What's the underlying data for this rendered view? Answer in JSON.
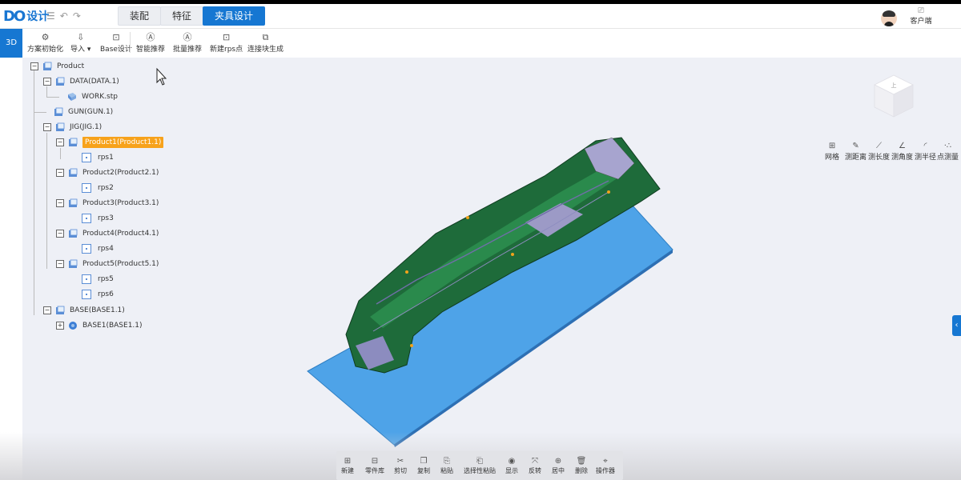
{
  "header": {
    "logo_mark": "DO",
    "logo_text": "设计",
    "tabs": [
      {
        "label": "装配"
      },
      {
        "label": "特征"
      },
      {
        "label": "夹具设计"
      }
    ],
    "client_label": "客户端"
  },
  "mode_button": "3D",
  "toolbar": {
    "items": [
      {
        "label": "方案初始化",
        "icon": "gear-icon"
      },
      {
        "label": "导入 ▾",
        "icon": "import-icon"
      },
      {
        "label": "Base设计",
        "icon": "base-design-icon"
      },
      {
        "label": "智能推荐",
        "icon": "smart-recommend-icon"
      },
      {
        "label": "批量推荐",
        "icon": "batch-recommend-icon"
      },
      {
        "label": "新建rps点",
        "icon": "new-rps-icon"
      },
      {
        "label": "连接块生成",
        "icon": "connector-block-icon"
      }
    ]
  },
  "tree": {
    "root": "Product",
    "data": "DATA(DATA.1)",
    "work": "WORK.stp",
    "gun": "GUN(GUN.1)",
    "jig": "JIG(JIG.1)",
    "p1": "Product1(Product1.1)",
    "rps1": "rps1",
    "p2": "Product2(Product2.1)",
    "rps2": "rps2",
    "p3": "Product3(Product3.1)",
    "rps3": "rps3",
    "p4": "Product4(Product4.1)",
    "rps4": "rps4",
    "p5": "Product5(Product5.1)",
    "rps5": "rps5",
    "rps6": "rps6",
    "base": "BASE(BASE1.1)",
    "base1": "BASE1(BASE1.1)"
  },
  "viewcube_label": "上",
  "measure_tools": [
    {
      "label": "网格",
      "icon": "grid-icon"
    },
    {
      "label": "测距离",
      "icon": "measure-distance-icon"
    },
    {
      "label": "测长度",
      "icon": "measure-length-icon"
    },
    {
      "label": "测角度",
      "icon": "measure-angle-icon"
    },
    {
      "label": "测半径",
      "icon": "measure-radius-icon"
    },
    {
      "label": "点测量",
      "icon": "point-measure-icon"
    }
  ],
  "bottom_tools": [
    {
      "label": "新建",
      "icon": "new-icon"
    },
    {
      "label": "零件库",
      "icon": "part-library-icon"
    },
    {
      "label": "剪切",
      "icon": "cut-icon"
    },
    {
      "label": "复制",
      "icon": "copy-icon"
    },
    {
      "label": "粘贴",
      "icon": "paste-icon"
    },
    {
      "label": "选择性粘贴",
      "icon": "paste-special-icon"
    },
    {
      "label": "显示",
      "icon": "show-icon"
    },
    {
      "label": "反转",
      "icon": "flip-icon"
    },
    {
      "label": "居中",
      "icon": "center-icon"
    },
    {
      "label": "删除",
      "icon": "delete-icon"
    },
    {
      "label": "操作器",
      "icon": "manipulator-icon"
    }
  ],
  "colors": {
    "accent": "#1677d2",
    "highlight": "#f7a21b",
    "plate": "#4ea3e8",
    "part": "#1e6b3a"
  }
}
